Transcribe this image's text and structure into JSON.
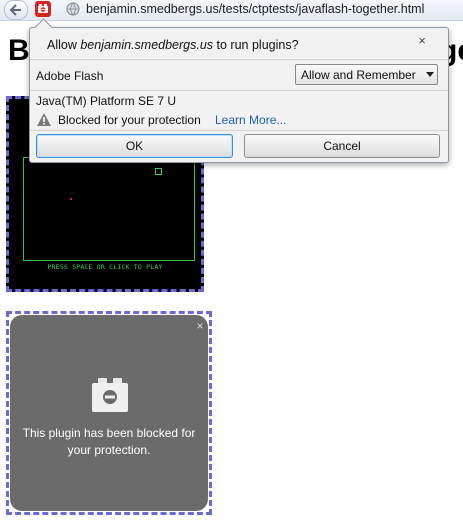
{
  "browser": {
    "url": "benjamin.smedbergs.us/tests/ctptests/javaflash-together.html"
  },
  "page": {
    "heading_left": "B",
    "heading_right": "ge"
  },
  "panel": {
    "title_prefix": "Allow ",
    "title_host": "benjamin.smedbergs.us",
    "title_suffix": " to run plugins?",
    "close_label": "×",
    "plugin1": {
      "name": "Adobe Flash",
      "selected_option": "Allow and Remember"
    },
    "plugin2": {
      "name": "Java(TM) Platform SE 7 U",
      "status": "Blocked for your protection",
      "learn_more": "Learn More..."
    },
    "ok_label": "OK",
    "cancel_label": "Cancel"
  },
  "flash_game": {
    "caption": "PRESS SPACE OR CLICK TO PLAY"
  },
  "blocked_plugin": {
    "close_label": "×",
    "message_line1": "This plugin has been blocked for",
    "message_line2": "your protection."
  },
  "colors": {
    "link": "#1d5fbf",
    "game_green": "#35d050",
    "dashed_border": "#6a6ad6",
    "blocked_bg": "#6b6b6b",
    "focus_blue": "#3b8fd8"
  },
  "icons": {
    "back": "back-arrow-icon",
    "plugin_notification": "plugin-blocked-icon",
    "site": "globe-icon",
    "warning": "warning-icon",
    "blocked_plugin": "plugin-brick-icon"
  }
}
